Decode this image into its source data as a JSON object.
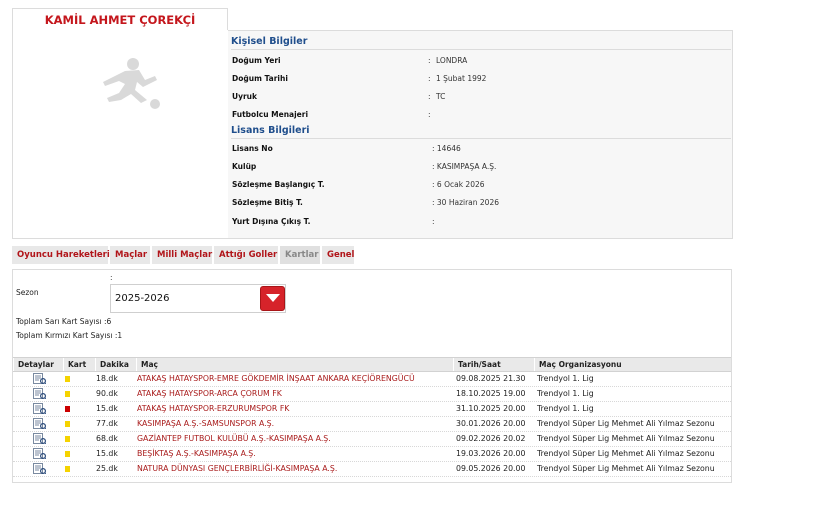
{
  "player": {
    "name": "KAMİL AHMET ÇOREKÇİ"
  },
  "personal": {
    "title": "Kişisel Bilgiler",
    "rows": [
      {
        "label": "Doğum Yeri",
        "colon": ":",
        "value": "LONDRA"
      },
      {
        "label": "Doğum Tarihi",
        "colon": ":",
        "value": "1 Şubat 1992"
      },
      {
        "label": "Uyruk",
        "colon": ":",
        "value": "TC"
      },
      {
        "label": "Futbolcu Menajeri",
        "colon": ":",
        "value": ""
      }
    ]
  },
  "license": {
    "title": "Lisans Bilgileri",
    "rows": [
      {
        "label": "Lisans No",
        "value": ": 14646"
      },
      {
        "label": "Kulüp",
        "value": ": KASIMPAŞA A.Ş."
      },
      {
        "label": "Sözleşme Başlangıç T.",
        "value": ": 6 Ocak 2026"
      },
      {
        "label": "Sözleşme Bitiş T.",
        "value": ": 30 Haziran 2026"
      },
      {
        "label": "Yurt Dışına Çıkış T.",
        "value": ":"
      }
    ]
  },
  "tabs": [
    {
      "label": "Oyuncu Hareketleri",
      "active": false
    },
    {
      "label": "Maçlar",
      "active": false
    },
    {
      "label": "Milli Maçlar",
      "active": false
    },
    {
      "label": "Attığı Goller",
      "active": false
    },
    {
      "label": "Kartlar",
      "active": true
    },
    {
      "label": "Genel",
      "active": false
    }
  ],
  "filter": {
    "colon": ":",
    "season_label": "Sezon",
    "season_value": "2025-2026",
    "yellow_total": "Toplam Sarı Kart Sayısı   :6",
    "red_total": "Toplam Kırmızı Kart Sayısı :1"
  },
  "table": {
    "headers": [
      "Detaylar",
      "Kart",
      "Dakika",
      "Maç",
      "Tarih/Saat",
      "Maç Organizasyonu"
    ],
    "rows": [
      {
        "card": "yellow",
        "minute": "18.dk",
        "match": "ATAKAŞ HATAYSPOR-EMRE GÖKDEMİR İNŞAAT ANKARA KEÇİÖRENGÜCÜ",
        "datetime": "09.08.2025 21.30",
        "org": "Trendyol 1. Lig"
      },
      {
        "card": "yellow",
        "minute": "90.dk",
        "match": "ATAKAŞ HATAYSPOR-ARCA ÇORUM FK",
        "datetime": "18.10.2025 19.00",
        "org": "Trendyol 1. Lig"
      },
      {
        "card": "red",
        "minute": "15.dk",
        "match": "ATAKAŞ HATAYSPOR-ERZURUMSPOR FK",
        "datetime": "31.10.2025 20.00",
        "org": "Trendyol 1. Lig"
      },
      {
        "card": "yellow",
        "minute": "77.dk",
        "match": "KASIMPAŞA A.Ş.-SAMSUNSPOR A.Ş.",
        "datetime": "30.01.2026 20.00",
        "org": "Trendyol Süper Lig Mehmet Ali Yılmaz Sezonu"
      },
      {
        "card": "yellow",
        "minute": "68.dk",
        "match": "GAZİANTEP FUTBOL KULÜBÜ A.Ş.-KASIMPAŞA A.Ş.",
        "datetime": "09.02.2026 20.02",
        "org": "Trendyol Süper Lig Mehmet Ali Yılmaz Sezonu"
      },
      {
        "card": "yellow",
        "minute": "15.dk",
        "match": "BEŞİKTAŞ A.Ş.-KASIMPAŞA A.Ş.",
        "datetime": "19.03.2026 20.00",
        "org": "Trendyol Süper Lig Mehmet Ali Yılmaz Sezonu"
      },
      {
        "card": "yellow",
        "minute": "25.dk",
        "match": "NATURA DÜNYASI GENÇLERBİRLİĞİ-KASIMPAŞA A.Ş.",
        "datetime": "09.05.2026 20.00",
        "org": "Trendyol Süper Lig Mehmet Ali Yılmaz Sezonu"
      }
    ]
  },
  "colors": {
    "brand_red": "#c4161c",
    "section_blue": "#1f4e8c",
    "yellow_card": "#f5d300",
    "red_card": "#cc0000"
  },
  "icons": {
    "photo": "player-silhouette-icon",
    "detail": "document-detail-icon",
    "dropdown": "chevron-down-icon"
  }
}
